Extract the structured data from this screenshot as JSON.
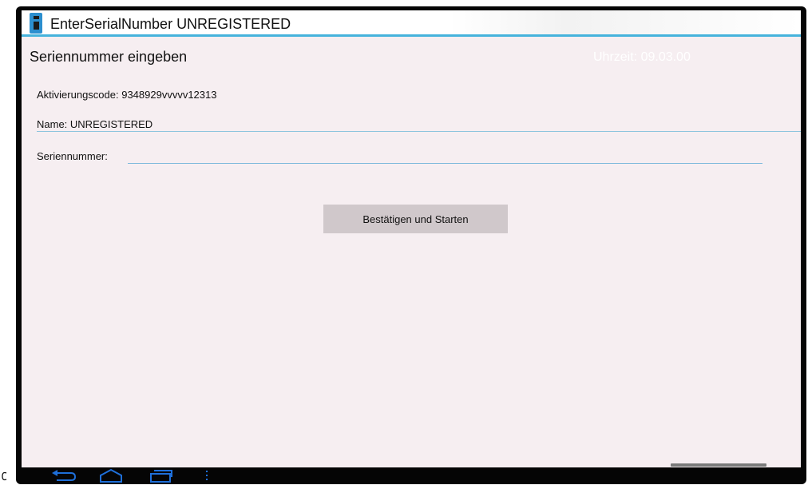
{
  "window": {
    "title": "EnterSerialNumber UNREGISTERED"
  },
  "header": {
    "title": "Seriennummer eingeben",
    "clock": "Uhrzeit: 09.03.00"
  },
  "form": {
    "activation_text": "Aktivierungscode: 9348929vvvvv12313",
    "name_text": "Name: UNREGISTERED",
    "serial_label": "Seriennummer:",
    "serial_value": ""
  },
  "actions": {
    "confirm_label": "Bestätigen und Starten"
  },
  "navbar": {
    "icons": [
      "back-icon",
      "home-icon",
      "recent-apps-icon",
      "menu-icon"
    ]
  },
  "colors": {
    "accent": "#45b3dc",
    "screen_bg": "#f6eef1",
    "button_bg": "#d0c8cb",
    "navbar_icon": "#1e6fd9"
  }
}
